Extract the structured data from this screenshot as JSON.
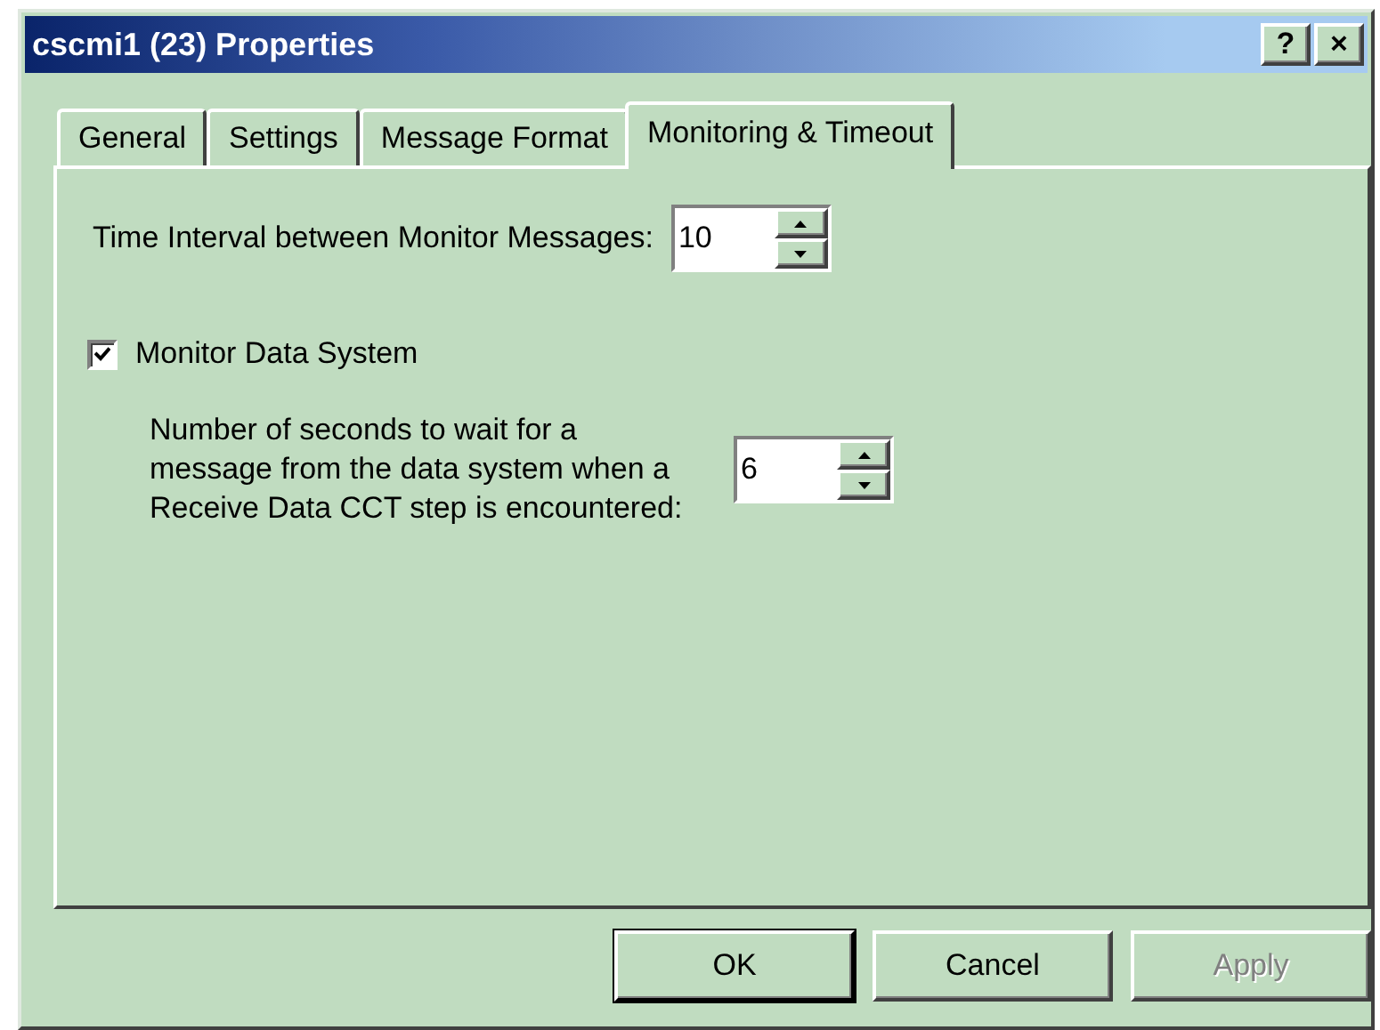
{
  "window": {
    "title": "cscmi1 (23) Properties",
    "help_button": "?",
    "close_button": "×"
  },
  "tabs": [
    {
      "label": "General",
      "selected": false
    },
    {
      "label": "Settings",
      "selected": false
    },
    {
      "label": "Message Format",
      "selected": false
    },
    {
      "label": "Monitoring & Timeout",
      "selected": true
    }
  ],
  "interval": {
    "label": "Time Interval between Monitor Messages:",
    "value": "10"
  },
  "monitor_data_system": {
    "label": "Monitor Data System",
    "checked": true
  },
  "wait": {
    "label": "Number of seconds to wait for a message from the data system when a Receive Data CCT step is encountered:",
    "value": "6"
  },
  "buttons": [
    {
      "label": "OK",
      "default": true,
      "disabled": false
    },
    {
      "label": "Cancel",
      "default": false,
      "disabled": false
    },
    {
      "label": "Apply",
      "default": false,
      "disabled": true
    }
  ]
}
